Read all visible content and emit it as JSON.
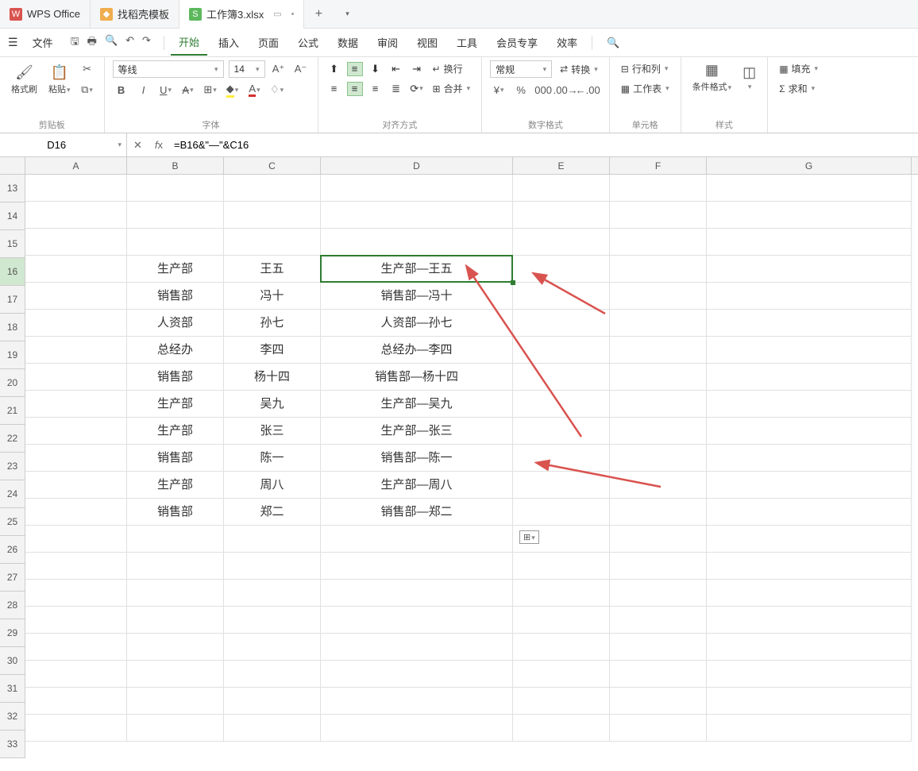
{
  "tabs": [
    {
      "icon": "W",
      "cls": "red",
      "label": "WPS Office"
    },
    {
      "icon": "◆",
      "cls": "orange",
      "label": "找稻壳模板"
    },
    {
      "icon": "S",
      "cls": "green",
      "label": "工作簿3.xlsx"
    }
  ],
  "menu": {
    "file": "文件",
    "items": [
      "开始",
      "插入",
      "页面",
      "公式",
      "数据",
      "审阅",
      "视图",
      "工具",
      "会员专享",
      "效率"
    ],
    "activeIndex": 0
  },
  "ribbon": {
    "clipboard": {
      "formatPainter": "格式刷",
      "paste": "粘贴",
      "label": "剪贴板"
    },
    "font": {
      "name": "等线",
      "size": "14",
      "label": "字体"
    },
    "align": {
      "wrap": "换行",
      "merge": "合并",
      "label": "对齐方式"
    },
    "number": {
      "format": "常规",
      "convert": "转换",
      "label": "数字格式"
    },
    "cells": {
      "rowcol": "行和列",
      "sheet": "工作表",
      "label": "单元格"
    },
    "style": {
      "cond": "条件格式",
      "label": "样式"
    },
    "edit": {
      "fill": "填充",
      "sum": "求和"
    }
  },
  "fx": {
    "cell": "D16",
    "formula": "=B16&\"—\"&C16"
  },
  "cols": [
    "A",
    "B",
    "C",
    "D",
    "E",
    "F",
    "G"
  ],
  "rowStart": 13,
  "rowEnd": 33,
  "data": {
    "16": {
      "B": "生产部",
      "C": "王五",
      "D": "生产部—王五"
    },
    "17": {
      "B": "销售部",
      "C": "冯十",
      "D": "销售部—冯十"
    },
    "18": {
      "B": "人资部",
      "C": "孙七",
      "D": "人资部—孙七"
    },
    "19": {
      "B": "总经办",
      "C": "李四",
      "D": "总经办—李四"
    },
    "20": {
      "B": "销售部",
      "C": "杨十四",
      "D": "销售部—杨十四"
    },
    "21": {
      "B": "生产部",
      "C": "吴九",
      "D": "生产部—吴九"
    },
    "22": {
      "B": "生产部",
      "C": "张三",
      "D": "生产部—张三"
    },
    "23": {
      "B": "销售部",
      "C": "陈一",
      "D": "销售部—陈一"
    },
    "24": {
      "B": "生产部",
      "C": "周八",
      "D": "生产部—周八"
    },
    "25": {
      "B": "销售部",
      "C": "郑二",
      "D": "销售部—郑二"
    }
  },
  "selected": {
    "row": 16,
    "col": "D"
  }
}
